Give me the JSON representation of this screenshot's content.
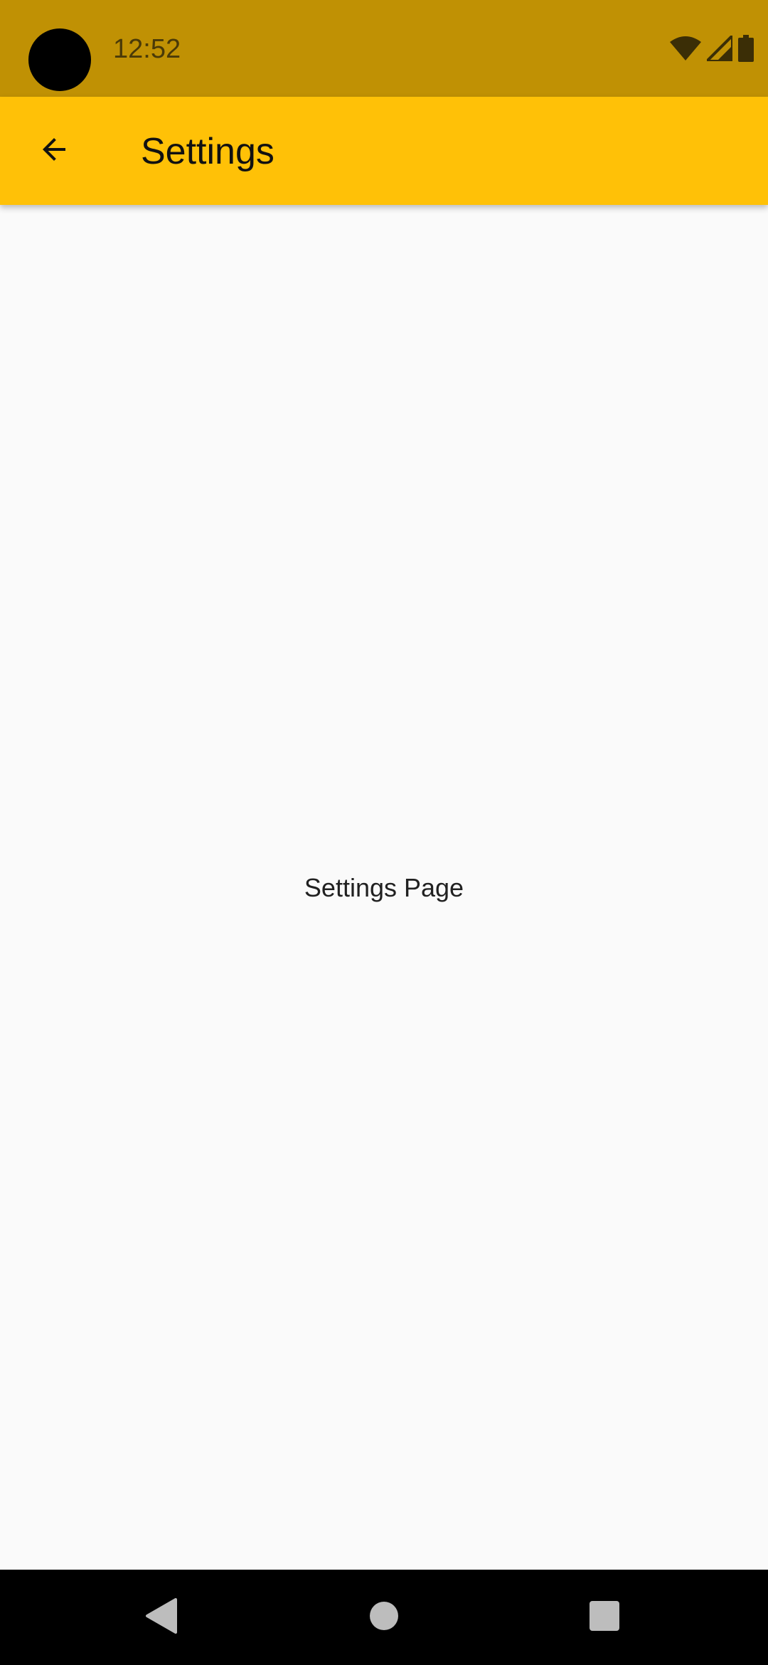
{
  "status_bar": {
    "time": "12:52",
    "icons": [
      "wifi-icon",
      "cell-signal-icon",
      "battery-icon"
    ],
    "background_color": "#c09104"
  },
  "app_bar": {
    "title": "Settings",
    "back_icon": "arrow-back-icon",
    "background_color": "#ffc107"
  },
  "content": {
    "text": "Settings Page"
  },
  "nav_bar": {
    "buttons": [
      "nav-back-icon",
      "nav-home-icon",
      "nav-recents-icon"
    ]
  }
}
